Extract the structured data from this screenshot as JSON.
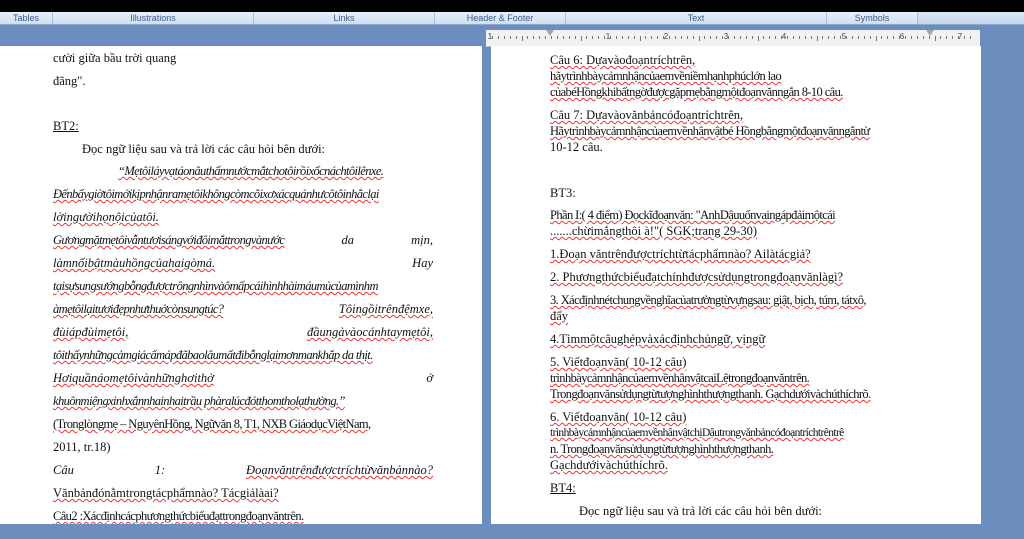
{
  "ribbon": {
    "groups": [
      "Tables",
      "Illustrations",
      "Links",
      "Header & Footer",
      "Text",
      "Symbols"
    ]
  },
  "ruler": {
    "numbers": [
      "1",
      "1",
      "2",
      "3",
      "4",
      "5",
      "6",
      "7"
    ]
  },
  "left_page": {
    "lines": [
      "cười giữa bầu trời quang",
      "đãng\".",
      "BT2:",
      "Đọc ngữ liệu sau và trả lời các câu hỏi bên dưới:",
      "“Mẹtôiláyvạtáonâuthấmnướcmắtchotôirồixốcnáchtôilênxe.",
      "Đếnbấygiờtôimớikịpnhậnramẹtôikhôngcòmcõixơxácquánhưcôtôinhắclại",
      "lờingườihọnộicủatôi.",
      "Gươngmặtmẹtôivẫntươisángvớiđôimắttrongvànước",
      "da",
      "mịn,",
      "làmnổibậtmàuhồngcủahaigòmá.",
      "Hay",
      "tạisựsungsướngbỗngđượctrôngnhìnvàômấpcáihìnhhàimáumủcủamìnhm",
      "àmẹtôilạitươiđẹpnhưthuởcònsungtúc?",
      "Tôingồitrênđệmxe,",
      "đùiápđùimẹtôi,",
      "đầungảvàocánhtaymẹtôi,",
      "tôithấynhữngcảmgiácấmápđãbaolâumấtđibỗnglạimơnmankhắp da thịt.",
      "Hơiquầnáomẹtôivànhữnghơithở",
      "ở",
      "khuônmiệngxinhxắnnhainhaitrầu phàralúcđótthomtholạthường.”",
      "(Tronglòngmẹ – NguyênHồng, Ngữvăn 8, T1, NXB GiáodụcViệtNam,",
      "2011, tr.18)",
      "Câu",
      "1:",
      "Đoạnvăntrênđượctríchtừvănbảnnào?",
      "Vănbảnđónằmtrongtácphẩmnào?  Tácgiảlàai?",
      "Câu2 :Xácđịnhcácphươngthứcbiểuđạttrongđoạnvăntrên."
    ]
  },
  "right_page": {
    "lines": [
      "Câu 6: Dựavàođoạntríchtrên,",
      "hãytrìnhbàycảmnhậncủaemvềniềmhạnhphúclớn lao",
      "củabéHồngkhibấtngờđượcgặpmẹbằngmộtđoạnvănngắn 8-10 câu.",
      "Câu 7: Dựavàovănbảncóđoạntríchtrên,",
      "Hãytrìnhbàycảmnhậncủaemvềnhânvậtbé Hồngbằngmộtđoạnvănngắntừ",
      "10-12 câu.",
      "BT3:",
      "Phần I:( 4 điểm) Đọckĩđoạnvăn: \"AnhDậuuốnvaingápđảimộtcái",
      ".......chừimắngthôi à!\"( SGK;trang 29-30)",
      "1.Đoạn văntrênđượctríchtừtácphẩmnào? Ailàtácgiả?",
      "2. Phươngthứcbiểuđạtchínhđượcsửdụngtrongđoạnvănlàgì?",
      "3. Xácđịnhnétchungvềnghĩacủatrườngtừvựngsau: giật, bịch, túm, tátxô,",
      "đẩy",
      "4.Tìmmộtcâughépvàxácđịnhchủngữ, vịngữ",
      "5. Viếtđoạnvăn( 10-12 câu)",
      "trìnhbàycảmnhậncủaemvềnhânvậtcaiLệtrongđoạnvăntrên.",
      "Trongđoạnvănsửdụngtừtượnghìnhthượngthanh. Gạchdướivàchúthíchrõ.",
      "6. Viếtđoạnvăn( 10-12 câu)",
      "trìnhbàycảmnhậncủaemvềnhânvậtchịDậutrongvănbảncóđoạntríchtrêntrê",
      "n. Trongđoạnvănsửdụngtừtượnghìnhthượngthanh.",
      "Gạchdướivàchúthíchrõ.",
      "BT4:",
      "Đọc ngữ liệu sau và trả lời các câu hỏi bên dưới:"
    ]
  }
}
